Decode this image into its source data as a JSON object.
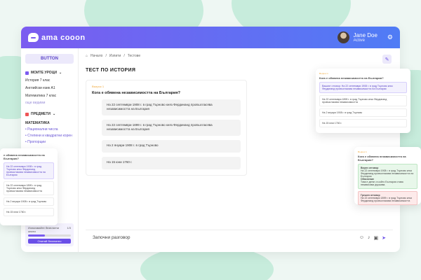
{
  "app": {
    "logo_text": "ama cooon"
  },
  "user": {
    "name": "Jane Doe",
    "status": "Active"
  },
  "sidebar": {
    "button_label": "BUTTON",
    "my_lessons_label": "МОИТЕ УРОЦИ",
    "lessons": [
      "История 7 клас",
      "Английски език А1",
      "Математика 7 клас"
    ],
    "show_more": "още видими",
    "subjects_label": "ПРЕДМЕТИ",
    "subject_name": "МАТЕМАТИКА",
    "topics": [
      "Рационални числа",
      "Степени и квадратни корен",
      "Пропорции"
    ],
    "promo_count": "1/3",
    "promo_text": "Използвайте безплатни опити",
    "promo_button": "Опитай безплатно"
  },
  "breadcrumb": {
    "home": "Начало",
    "middle": "Изпити",
    "current": "Тестове"
  },
  "main": {
    "page_title": "ТЕСТ ПО ИСТОРИЯ"
  },
  "question": {
    "label": "Въпрос 1",
    "text": "Кога е обявена независимостта на България?",
    "options": [
      "На 22 септември 1908 г. в град Търново княз Фердинанд провъзгласява независимостта на България",
      "На 22 септември 1899 г. в град Търново княз Фердинанд провъзгласява независимостта на България",
      "На 2 януари 1908 г. в град Търново",
      "На 15 юни 1760 г."
    ]
  },
  "chat": {
    "placeholder": "Започни разговор"
  },
  "float_right_1": {
    "label": "Въпрос 1",
    "question": "Кога е обявена независимостта на България?",
    "options": [
      "Вашият отговор: На 22 септември 1908 г. в град Търново княз Фердинанд провъзгласява независимостта на България",
      "На 22 септември 1899 г. в град Търново княз Фердинанд провъзгласява независимостта",
      "На 2 януари 1908 г. в град Търново",
      "На 15 юни 1760 г."
    ]
  },
  "float_right_2": {
    "label": "Въпрос 1",
    "question": "Кога е обявена независимостта на България?",
    "correct_title": "Верен отговор",
    "correct_text": "На 22 септември 1908 г. в град Търново княз Фердинанд провъзгласява независимостта на България",
    "explain_title": "Обяснение",
    "explain_text": "Това е денят, в който България става независима държава.",
    "wrong_title": "Грешен отговор",
    "wrong_text": "На 22 септември 1899 г. в град Търново княз Фердинанд провъзгласява независимостта"
  },
  "float_left": {
    "question": "е обявена независимостта на България?",
    "options": [
      "На 22 септември 1908 г. в град Търново княз Фердинанд провъзгласява независимостта на България",
      "На 22 септември 1899 г. в град Търново княз Фердинанд провъзгласява независимостта",
      "На 2 януари 1908 г. в град Търново",
      "На 15 юни 1760 г."
    ]
  }
}
